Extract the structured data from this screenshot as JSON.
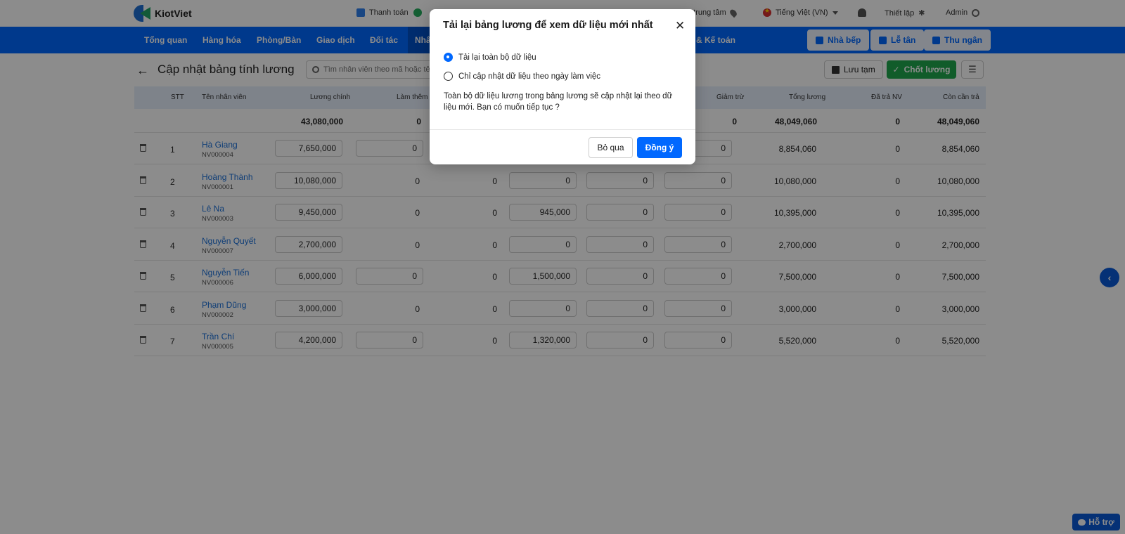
{
  "app": {
    "name": "KiotViet"
  },
  "topbar": {
    "payment_label": "Thanh toán",
    "branch_label": "h trung tâm",
    "language_label": "Tiếng Việt (VN)",
    "settings_label": "Thiết lập",
    "user_label": "Admin"
  },
  "nav": {
    "items": [
      "Tổng quan",
      "Hàng hóa",
      "Phòng/Bàn",
      "Giao dịch",
      "Đối tác",
      "Nhâ",
      "& Kế toán"
    ],
    "buttons": [
      "Nhà bếp",
      "Lễ tân",
      "Thu ngân"
    ]
  },
  "page": {
    "title": "Cập nhật bảng tính lương",
    "search_placeholder": "Tìm nhân viên theo mã hoặc tên",
    "save_label": "Lưu tạm",
    "finalize_label": "Chốt lương"
  },
  "table": {
    "headers": {
      "stt": "STT",
      "name": "Tên nhân viên",
      "base": "Lương chính",
      "overtime": "Làm thêm",
      "deduction": "Giảm trừ",
      "total": "Tổng lương",
      "paid": "Đã trả NV",
      "remaining": "Còn cần trả"
    },
    "totals": {
      "base": "43,080,000",
      "overtime": "0",
      "deduction": "0",
      "total": "48,049,060",
      "paid": "0",
      "remaining": "48,049,060"
    },
    "rows": [
      {
        "stt": "1",
        "name": "Hà Giang",
        "code": "NV000004",
        "base": "7,650,000",
        "overtime": "0",
        "c3": "",
        "c4": "",
        "c5": "",
        "deduction": "0",
        "total": "8,854,060",
        "paid": "0",
        "remaining": "8,854,060"
      },
      {
        "stt": "2",
        "name": "Hoàng Thành",
        "code": "NV000001",
        "base": "10,080,000",
        "overtime": "0",
        "c3": "0",
        "c4": "0",
        "c5": "0",
        "deduction": "0",
        "total": "10,080,000",
        "paid": "0",
        "remaining": "10,080,000"
      },
      {
        "stt": "3",
        "name": "Lê Na",
        "code": "NV000003",
        "base": "9,450,000",
        "overtime": "0",
        "c3": "0",
        "c4": "945,000",
        "c5": "0",
        "deduction": "0",
        "total": "10,395,000",
        "paid": "0",
        "remaining": "10,395,000"
      },
      {
        "stt": "4",
        "name": "Nguyễn Quyết",
        "code": "NV000007",
        "base": "2,700,000",
        "overtime": "0",
        "c3": "0",
        "c4": "0",
        "c5": "0",
        "deduction": "0",
        "total": "2,700,000",
        "paid": "0",
        "remaining": "2,700,000"
      },
      {
        "stt": "5",
        "name": "Nguyễn Tiến",
        "code": "NV000006",
        "base": "6,000,000",
        "overtime": "0",
        "c3": "0",
        "c4": "1,500,000",
        "c5": "0",
        "deduction": "0",
        "total": "7,500,000",
        "paid": "0",
        "remaining": "7,500,000"
      },
      {
        "stt": "6",
        "name": "Phạm Dũng",
        "code": "NV000002",
        "base": "3,000,000",
        "overtime": "0",
        "c3": "0",
        "c4": "0",
        "c5": "0",
        "deduction": "0",
        "total": "3,000,000",
        "paid": "0",
        "remaining": "3,000,000"
      },
      {
        "stt": "7",
        "name": "Trần Chí",
        "code": "NV000005",
        "base": "4,200,000",
        "overtime": "0",
        "c3": "0",
        "c4": "1,320,000",
        "c5": "0",
        "deduction": "0",
        "total": "5,520,000",
        "paid": "0",
        "remaining": "5,520,000"
      }
    ]
  },
  "dialog": {
    "title": "Tải lại bảng lương để xem dữ liệu mới nhất",
    "option_all": "Tải lại toàn bộ dữ liệu",
    "option_days": "Chỉ cập nhật dữ liệu theo ngày làm việc",
    "message": "Toàn bộ dữ liệu lương trong bảng lương sẽ cập nhật lại theo dữ liệu mới. Bạn có muốn tiếp tục ?",
    "cancel_label": "Bỏ qua",
    "confirm_label": "Đồng ý"
  },
  "help_label": "Hỗ trợ",
  "colors": {
    "primary": "#0068ff",
    "success": "#1fa84d",
    "link": "#1a6fd8"
  }
}
